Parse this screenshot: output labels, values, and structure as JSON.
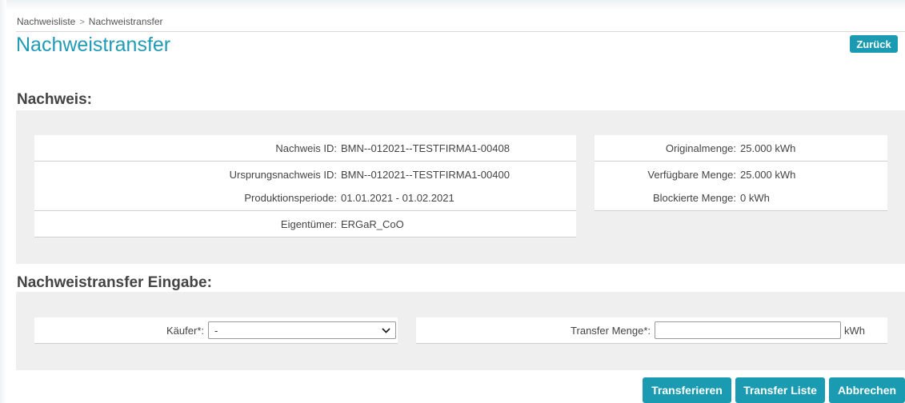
{
  "breadcrumb": {
    "items": [
      "Nachweisliste",
      "Nachweistransfer"
    ],
    "separator": ">"
  },
  "page": {
    "title": "Nachweistransfer",
    "back_label": "Zurück"
  },
  "nachweis": {
    "section_title": "Nachweis:",
    "left_fields": [
      {
        "label": "Nachweis ID:",
        "value": "BMN--012021--TESTFIRMA1-00408"
      },
      {
        "label": "Ursprungsnachweis ID:",
        "value": "BMN--012021--TESTFIRMA1-00400"
      },
      {
        "label": "Produktionsperiode:",
        "value": "01.01.2021 - 01.02.2021"
      },
      {
        "label": "Eigentümer:",
        "value": "ERGaR_CoO"
      }
    ],
    "right_fields": [
      {
        "label": "Originalmenge:",
        "value": "25.000 kWh"
      },
      {
        "label": "Verfügbare Menge:",
        "value": "25.000 kWh"
      },
      {
        "label": "Blockierte Menge:",
        "value": "0 kWh"
      }
    ]
  },
  "eingabe": {
    "section_title": "Nachweistransfer Eingabe:",
    "kaeufer_label": "Käufer*:",
    "kaeufer_value": "-",
    "menge_label": "Transfer Menge*:",
    "menge_value": "",
    "menge_unit": "kWh"
  },
  "footer": {
    "transfer_label": "Transferieren",
    "list_label": "Transfer Liste",
    "cancel_label": "Abbrechen"
  },
  "colors": {
    "accent": "#1a9bb2",
    "title": "#1f9bb6",
    "panel": "#efefef"
  }
}
